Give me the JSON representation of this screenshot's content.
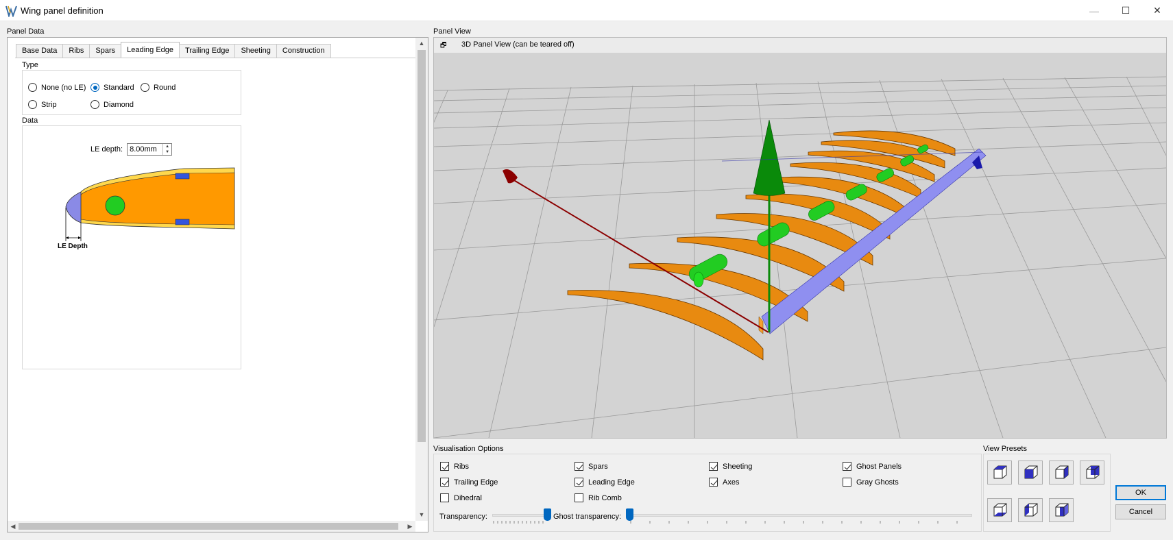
{
  "window": {
    "title": "Wing panel definition",
    "minimize": "—",
    "maximize": "☐",
    "close": "✕"
  },
  "panel_data": {
    "label": "Panel Data",
    "tabs": [
      {
        "label": "Base Data"
      },
      {
        "label": "Ribs"
      },
      {
        "label": "Spars"
      },
      {
        "label": "Leading Edge",
        "active": true
      },
      {
        "label": "Trailing Edge"
      },
      {
        "label": "Sheeting"
      },
      {
        "label": "Construction"
      }
    ],
    "type_group": {
      "title": "Type",
      "options": [
        {
          "label": "None (no LE)",
          "checked": false
        },
        {
          "label": "Standard",
          "checked": true
        },
        {
          "label": "Round",
          "checked": false
        },
        {
          "label": "Strip",
          "checked": false
        },
        {
          "label": "Diamond",
          "checked": false
        }
      ]
    },
    "data_group": {
      "title": "Data",
      "le_depth_label": "LE depth:",
      "le_depth_value": "8.00mm",
      "diagram_caption": "LE Depth"
    }
  },
  "panel_view": {
    "label": "Panel View",
    "header_text": "3D Panel View (can be teared off)",
    "float_icon": "restore-window-icon"
  },
  "visualisation": {
    "title": "Visualisation Options",
    "options": [
      {
        "label": "Ribs",
        "checked": true
      },
      {
        "label": "Spars",
        "checked": true
      },
      {
        "label": "Sheeting",
        "checked": true
      },
      {
        "label": "Ghost Panels",
        "checked": true
      },
      {
        "label": "Trailing Edge",
        "checked": true
      },
      {
        "label": "Leading Edge",
        "checked": true
      },
      {
        "label": "Axes",
        "checked": true
      },
      {
        "label": "Gray Ghosts",
        "checked": false
      },
      {
        "label": "Dihedral",
        "checked": false
      },
      {
        "label": "Rib Comb",
        "checked": false
      }
    ],
    "transparency_label": "Transparency:",
    "ghost_transparency_label": "Ghost transparency:",
    "transparency_value": 1.0,
    "ghost_transparency_value": 0.0
  },
  "view_presets": {
    "title": "View Presets"
  },
  "buttons": {
    "ok": "OK",
    "cancel": "Cancel"
  },
  "colors": {
    "accent": "#0067c0",
    "rib": "#ff8c00",
    "spar": "#22cc22",
    "edge": "#8f8ff0",
    "axis_red": "#8b0000",
    "axis_green": "#0a8a0a"
  }
}
